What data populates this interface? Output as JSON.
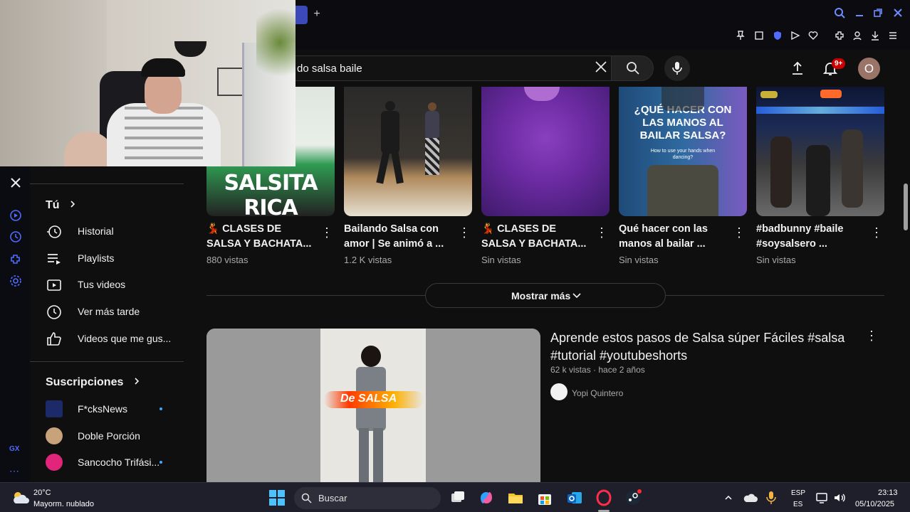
{
  "search": {
    "query_visible": "do salsa baile"
  },
  "header": {
    "notification_badge": "9+",
    "account_initial": "O"
  },
  "sidebar": {
    "you_heading": "Tú",
    "items": [
      {
        "label": "Historial",
        "icon": "history-icon"
      },
      {
        "label": "Playlists",
        "icon": "playlist-icon"
      },
      {
        "label": "Tus videos",
        "icon": "your-videos-icon"
      },
      {
        "label": "Ver más tarde",
        "icon": "watch-later-icon"
      },
      {
        "label": "Videos que me gus...",
        "icon": "like-icon"
      }
    ],
    "subscriptions_heading": "Suscripciones",
    "subscriptions": [
      {
        "label": "F*cksNews",
        "new": true
      },
      {
        "label": "Doble Porción",
        "new": false
      },
      {
        "label": "Sancocho Trifási...",
        "new": true
      }
    ]
  },
  "shorts": [
    {
      "title_line1": "💃 CLASES DE",
      "title_line2": "SALSA Y BACHATA...",
      "views": "880 vistas",
      "overlay_text": "SALSITA RICA"
    },
    {
      "title_line1": "Bailando Salsa con",
      "title_line2": "amor | Se animó a ...",
      "views": "1.2 K vistas",
      "overlay_text": ""
    },
    {
      "title_line1": "💃 CLASES DE",
      "title_line2": "SALSA Y BACHATA...",
      "views": "Sin vistas",
      "overlay_text": ""
    },
    {
      "title_line1": "Qué hacer con las",
      "title_line2": "manos al bailar ...",
      "views": "Sin vistas",
      "overlay_text": "¿QUÉ HACER CON LAS MANOS AL BAILAR SALSA?",
      "overlay_sub": "How to use your hands when dancing?"
    },
    {
      "title_line1": "#badbunny #baile",
      "title_line2": "#soysalsero ...",
      "views": "Sin vistas",
      "overlay_text": ""
    }
  ],
  "show_more_label": "Mostrar más",
  "video": {
    "title": "Aprende estos pasos de Salsa súper Fáciles #salsa #tutorial #youtubeshorts",
    "meta": "62 k vistas · hace 2 años",
    "channel": "Yopi Quintero",
    "thumb_text": "De SALSA"
  },
  "opera": {
    "gx_label": "GX"
  },
  "taskbar": {
    "weather_temp": "20°C",
    "weather_desc": "Mayorm. nublado",
    "search_label": "Buscar",
    "lang1": "ESP",
    "lang2": "ES",
    "time": "23:13",
    "date": "05/10/2025"
  },
  "colors": {
    "yt_bg": "#0f0f0f",
    "accent": "#3ea6ff",
    "badge": "#cc0000",
    "opera_blue": "#6f8cff"
  }
}
